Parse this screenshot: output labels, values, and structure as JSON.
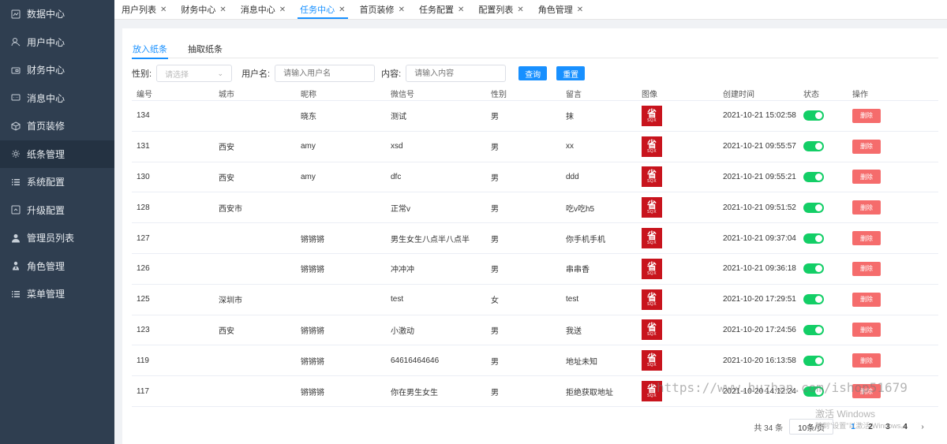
{
  "sidebar": {
    "items": [
      {
        "label": "数据中心",
        "icon": "chart-icon"
      },
      {
        "label": "用户中心",
        "icon": "user-icon"
      },
      {
        "label": "财务中心",
        "icon": "wallet-icon"
      },
      {
        "label": "消息中心",
        "icon": "message-icon"
      },
      {
        "label": "首页装修",
        "icon": "box-icon"
      },
      {
        "label": "纸条管理",
        "icon": "gear-icon"
      },
      {
        "label": "系统配置",
        "icon": "list-icon"
      },
      {
        "label": "升级配置",
        "icon": "upgrade-icon"
      },
      {
        "label": "管理员列表",
        "icon": "admin-icon"
      },
      {
        "label": "角色管理",
        "icon": "role-icon"
      },
      {
        "label": "菜单管理",
        "icon": "menu-icon"
      }
    ],
    "active_index": 5
  },
  "tabs": [
    {
      "label": "用户列表"
    },
    {
      "label": "财务中心"
    },
    {
      "label": "消息中心"
    },
    {
      "label": "任务中心",
      "active": true
    },
    {
      "label": "首页装修"
    },
    {
      "label": "任务配置"
    },
    {
      "label": "配置列表"
    },
    {
      "label": "角色管理"
    }
  ],
  "subtabs": [
    {
      "label": "放入纸条",
      "active": true
    },
    {
      "label": "抽取纸条"
    }
  ],
  "filters": {
    "gender_label": "性别:",
    "gender_placeholder": "请选择",
    "username_label": "用户名:",
    "username_placeholder": "请输入用户名",
    "content_label": "内容:",
    "content_placeholder": "请输入内容",
    "search_button": "查询",
    "reset_button": "重置"
  },
  "table": {
    "columns": [
      "编号",
      "城市",
      "昵称",
      "微信号",
      "性别",
      "留言",
      "图像",
      "创建时间",
      "状态",
      "操作"
    ],
    "thumb_big": "省",
    "thumb_small": "SQX",
    "delete_label": "删除",
    "rows": [
      {
        "id": "134",
        "city": "",
        "nickname": "晓东",
        "wechat": "测试",
        "gender": "男",
        "message": "抹",
        "created": "2021-10-21 15:02:58",
        "status": true
      },
      {
        "id": "131",
        "city": "西安",
        "nickname": "amy",
        "wechat": "xsd",
        "gender": "男",
        "message": "xx",
        "created": "2021-10-21 09:55:57",
        "status": true
      },
      {
        "id": "130",
        "city": "西安",
        "nickname": "amy",
        "wechat": "dfc",
        "gender": "男",
        "message": "ddd",
        "created": "2021-10-21 09:55:21",
        "status": true
      },
      {
        "id": "128",
        "city": "西安市",
        "nickname": "",
        "wechat": "正常v",
        "gender": "男",
        "message": "吃v吃h5",
        "created": "2021-10-21 09:51:52",
        "status": true
      },
      {
        "id": "127",
        "city": "",
        "nickname": "锵锵锵",
        "wechat": "男生女生八点半八点半",
        "gender": "男",
        "message": "你手机手机",
        "created": "2021-10-21 09:37:04",
        "status": true
      },
      {
        "id": "126",
        "city": "",
        "nickname": "锵锵锵",
        "wechat": "冲冲冲",
        "gender": "男",
        "message": "串串香",
        "created": "2021-10-21 09:36:18",
        "status": true
      },
      {
        "id": "125",
        "city": "深圳市",
        "nickname": "",
        "wechat": "test",
        "gender": "女",
        "message": "test",
        "created": "2021-10-20 17:29:51",
        "status": true
      },
      {
        "id": "123",
        "city": "西安",
        "nickname": "锵锵锵",
        "wechat": "小激动",
        "gender": "男",
        "message": "我送",
        "created": "2021-10-20 17:24:56",
        "status": true
      },
      {
        "id": "119",
        "city": "",
        "nickname": "锵锵锵",
        "wechat": "64616464646",
        "gender": "男",
        "message": "地址未知",
        "created": "2021-10-20 16:13:58",
        "status": true
      },
      {
        "id": "117",
        "city": "",
        "nickname": "锵锵锵",
        "wechat": "你在男生女生",
        "gender": "男",
        "message": "拒绝获取地址",
        "created": "2021-10-20 14:12:24",
        "status": true
      }
    ]
  },
  "pagination": {
    "total_text": "共 34 条",
    "page_size": "10条/页",
    "pages": [
      "1",
      "2",
      "3",
      "4"
    ],
    "current_page": "1",
    "next": "›"
  },
  "watermark": {
    "url": "https://www.huzhan.com/ishop51679",
    "win_title": "激活 Windows",
    "win_sub": "转到\"设置\"以激活 Windows。"
  },
  "colors": {
    "sidebar_bg": "#2f3e50",
    "accent": "#1890ff",
    "danger": "#f56c6c",
    "toggle_on": "#13ce66",
    "thumb_red": "#c8141d"
  }
}
